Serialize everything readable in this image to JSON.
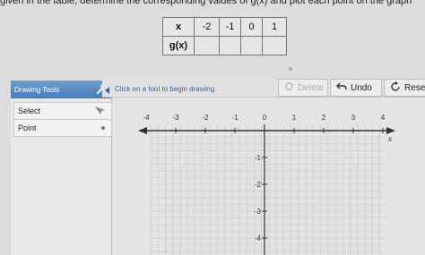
{
  "instruction": "given in the table, determine the corresponding values of g(x) and plot each point on the graph",
  "table": {
    "x_header": "x",
    "gx_header": "g(x)",
    "x_values": [
      "-2",
      "-1",
      "0",
      "1"
    ],
    "gx_values": [
      "",
      "",
      "",
      ""
    ]
  },
  "tools": {
    "header": "Drawing Tools",
    "items": [
      "Select",
      "Point"
    ]
  },
  "status": {
    "message": "Click on a tool to begin drawing.",
    "delete_label": "Delete",
    "undo_label": "Undo",
    "reset_label": "Reset"
  },
  "graph": {
    "x_axis_label": "x",
    "x_tick_labels": [
      "-4",
      "-3",
      "-2",
      "-1",
      "0",
      "1",
      "2",
      "3",
      "4"
    ],
    "y_tick_labels": [
      "-1",
      "-2",
      "-3",
      "-4"
    ]
  },
  "colors": {
    "axis": "#333333",
    "grid": "#c6c6c6",
    "header_blue": "#5a8cc4",
    "status_text": "#3c5e9c"
  }
}
